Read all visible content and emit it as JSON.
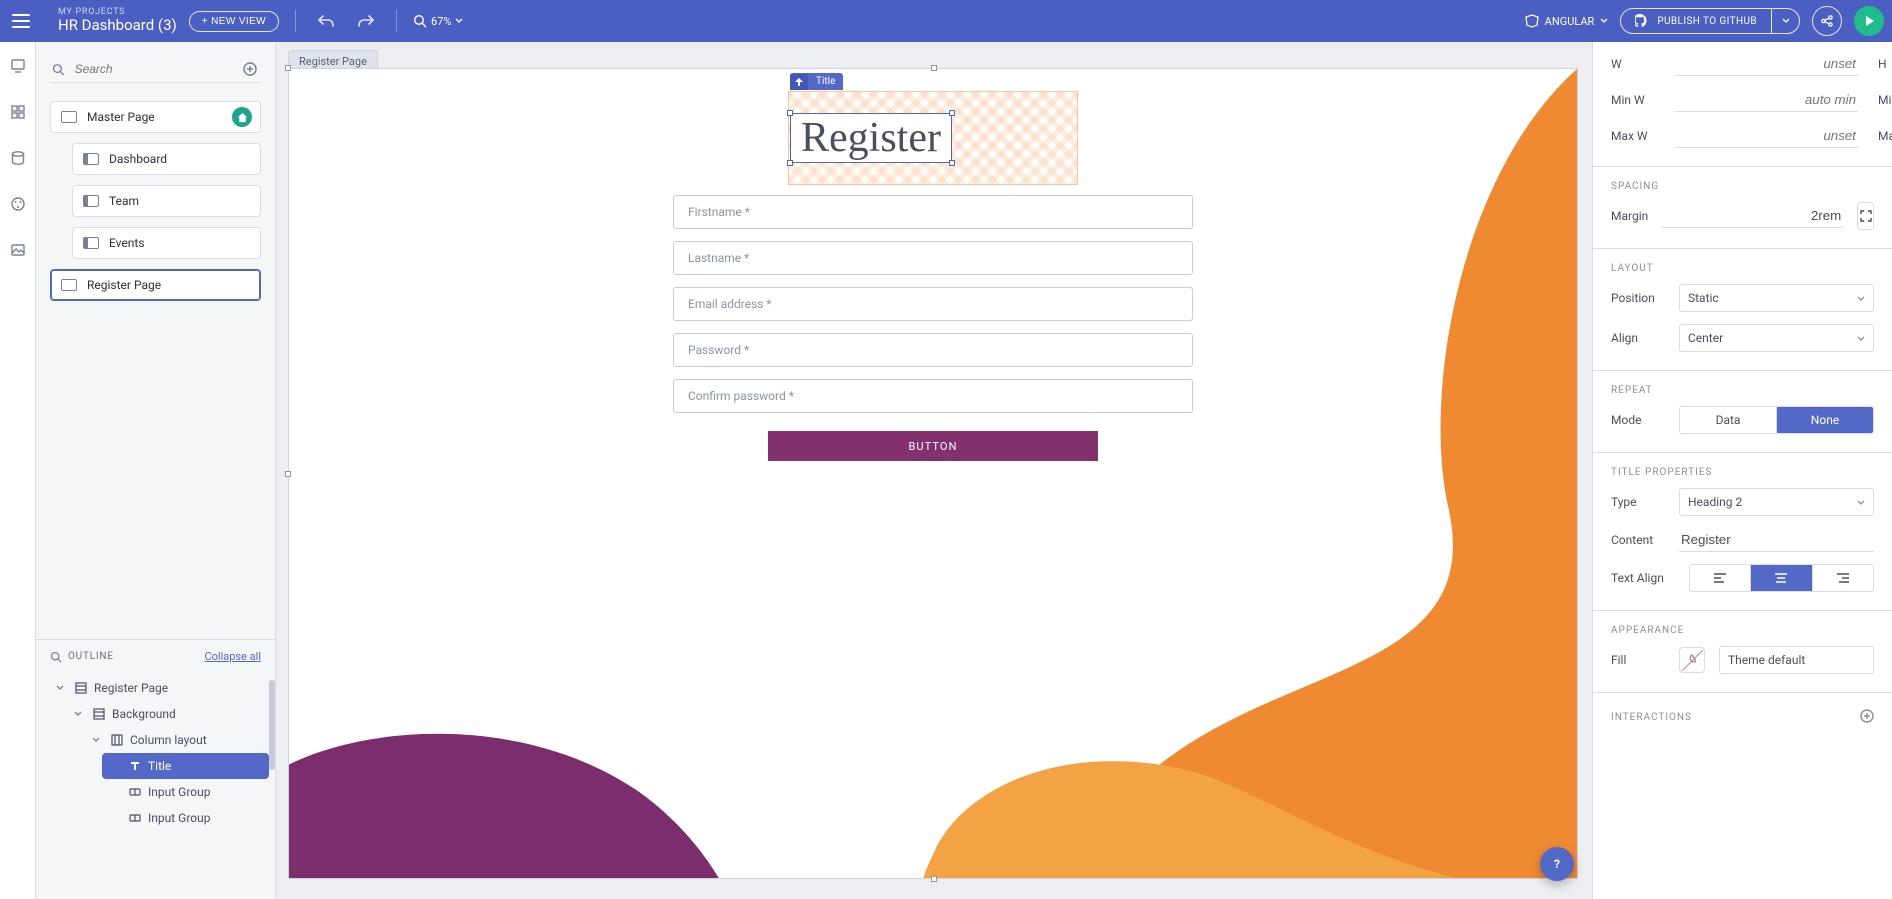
{
  "header": {
    "breadcrumb": "MY PROJECTS",
    "project": "HR Dashboard (3)",
    "new_view": "+ NEW VIEW",
    "zoom": "67%",
    "framework": "ANGULAR",
    "publish": "PUBLISH TO GITHUB"
  },
  "search": {
    "placeholder": "Search"
  },
  "pages": {
    "master": "Master Page",
    "dashboard": "Dashboard",
    "team": "Team",
    "events": "Events",
    "register": "Register Page"
  },
  "outline": {
    "label": "OUTLINE",
    "collapse": "Collapse all",
    "items": [
      "Register Page",
      "Background",
      "Column layout",
      "Title",
      "Input Group",
      "Input Group"
    ]
  },
  "canvas": {
    "tab": "Register Page",
    "mini_tab": "Title",
    "title": "Register",
    "fields": [
      "Firstname *",
      "Lastname *",
      "Email address *",
      "Password *",
      "Confirm password *"
    ],
    "button": "BUTTON"
  },
  "props": {
    "size": {
      "w_label": "W",
      "w": "unset",
      "h_label": "H",
      "h": "--",
      "minw_label": "Min W",
      "minw": "auto min",
      "minh_label": "Min H",
      "minh": "--",
      "maxw_label": "Max W",
      "maxw": "unset",
      "maxh_label": "Max H",
      "maxh": "--"
    },
    "spacing": {
      "section": "SPACING",
      "margin_label": "Margin",
      "margin_value": "2rem"
    },
    "layout": {
      "section": "LAYOUT",
      "position_label": "Position",
      "position": "Static",
      "align_label": "Align",
      "align": "Center"
    },
    "repeat": {
      "section": "REPEAT",
      "mode_label": "Mode",
      "data": "Data",
      "none": "None"
    },
    "title": {
      "section": "TITLE PROPERTIES",
      "type_label": "Type",
      "type": "Heading 2",
      "content_label": "Content",
      "content": "Register",
      "text_align_label": "Text Align"
    },
    "appearance": {
      "section": "APPEARANCE",
      "fill_label": "Fill",
      "fill": "Theme default"
    },
    "interactions": {
      "section": "INTERACTIONS"
    }
  },
  "help": "?"
}
